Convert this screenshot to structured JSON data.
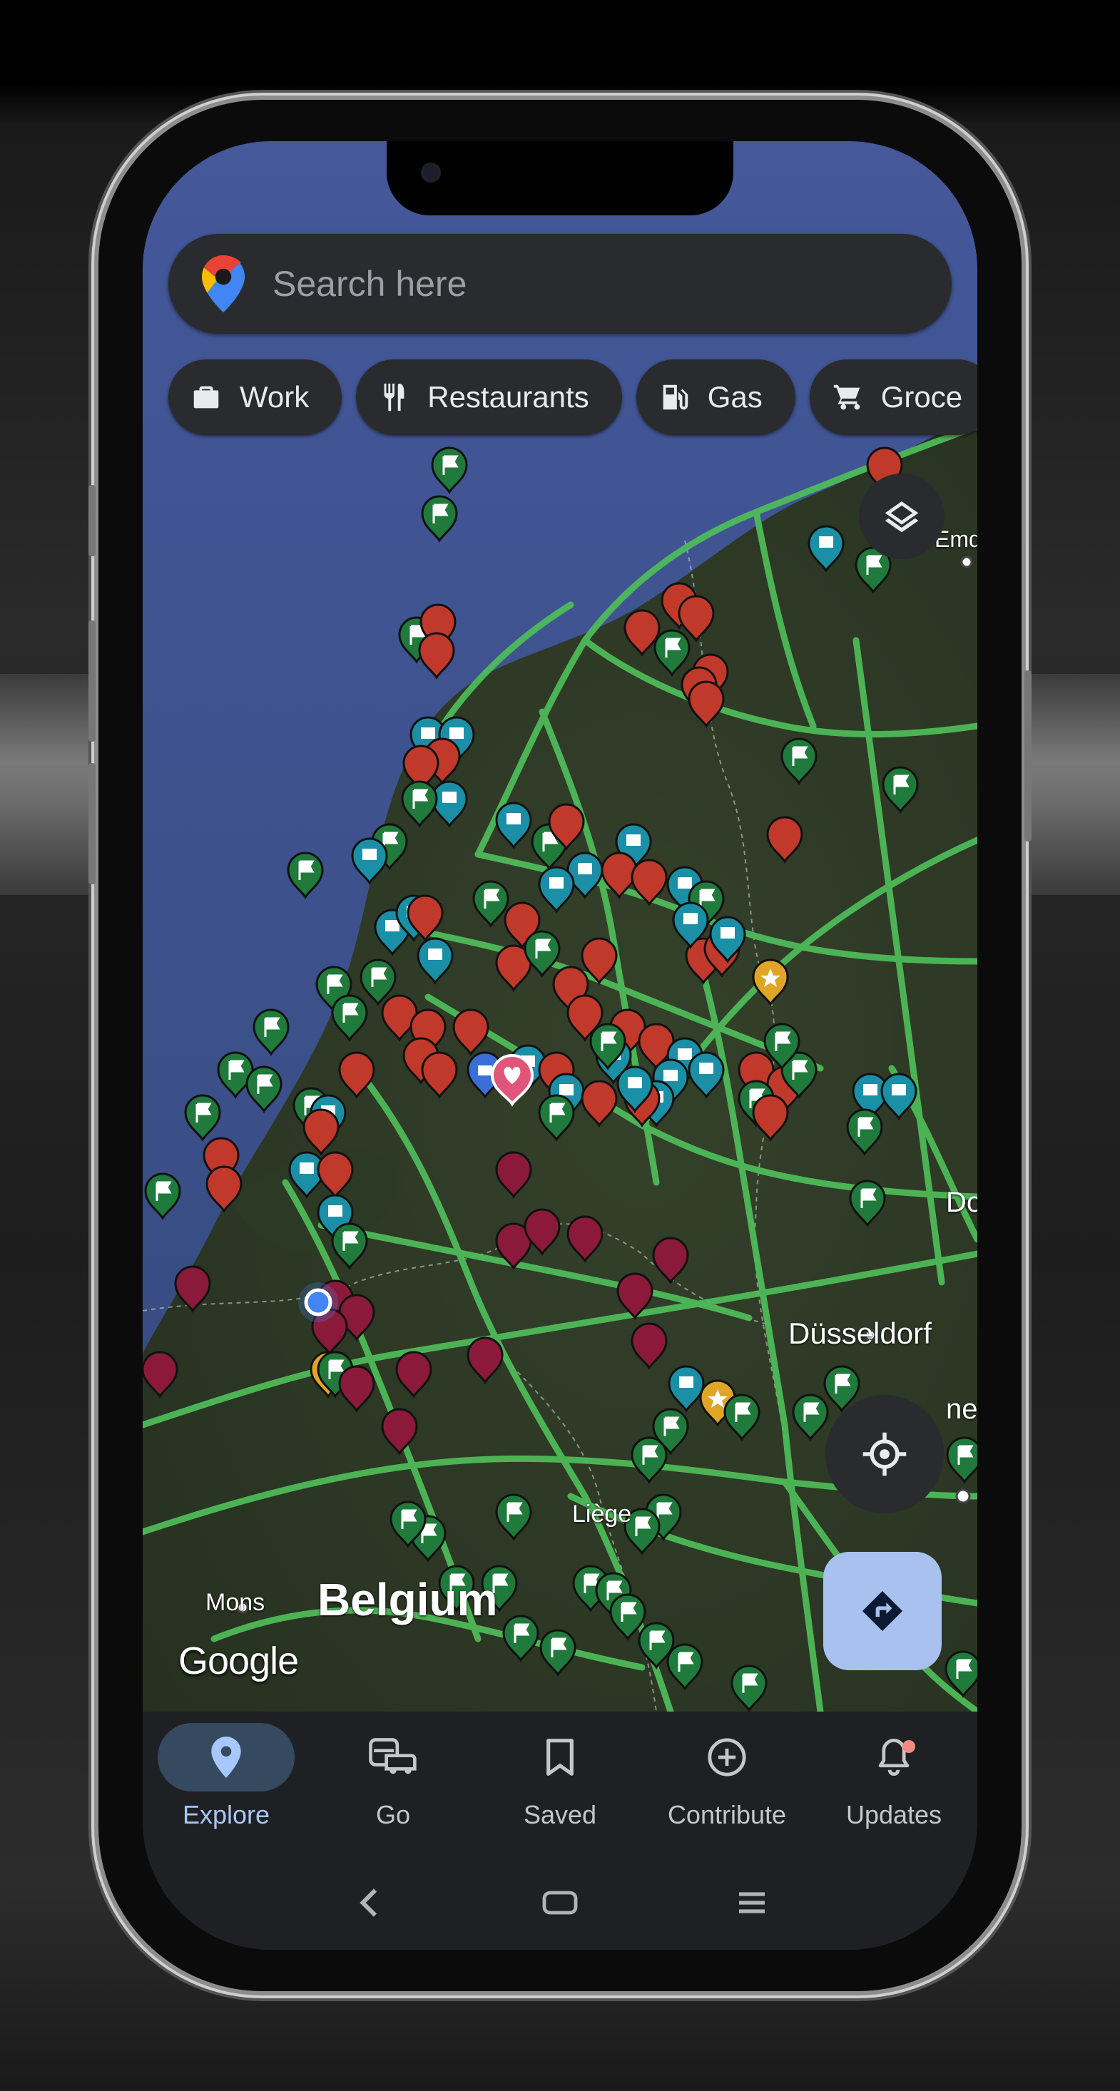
{
  "search": {
    "placeholder": "Search here"
  },
  "chips": [
    {
      "label": "Work",
      "icon": "briefcase-icon"
    },
    {
      "label": "Restaurants",
      "icon": "fork-knife-icon"
    },
    {
      "label": "Gas",
      "icon": "gas-station-icon"
    },
    {
      "label": "Groce",
      "icon": "cart-icon"
    }
  ],
  "map": {
    "attribution": "Google",
    "labels": {
      "mons": "Mons",
      "belgium": "Belgium",
      "dusseldorf": "Düsseldorf",
      "liege": "Liège",
      "emden": "Emd",
      "dortmund": "Do",
      "cologne": "ne"
    },
    "colors": {
      "water": "#3b4f86",
      "land": "#2d3a24",
      "traffic_route": "#4fbe5a",
      "pin_red": "#c0392b",
      "pin_maroon": "#8b1a3a",
      "pin_green": "#1f7a3c",
      "pin_teal": "#1a8fa6",
      "pin_yellow": "#e0a526",
      "pin_blue": "#3a6fd8"
    }
  },
  "bottom_nav": [
    {
      "label": "Explore",
      "icon": "explore-pin-icon",
      "active": true
    },
    {
      "label": "Go",
      "icon": "commute-icon",
      "active": false
    },
    {
      "label": "Saved",
      "icon": "bookmark-icon",
      "active": false
    },
    {
      "label": "Contribute",
      "icon": "add-circle-icon",
      "active": false
    },
    {
      "label": "Updates",
      "icon": "bell-icon",
      "active": false
    }
  ],
  "accent_color": "#a8c7fa"
}
